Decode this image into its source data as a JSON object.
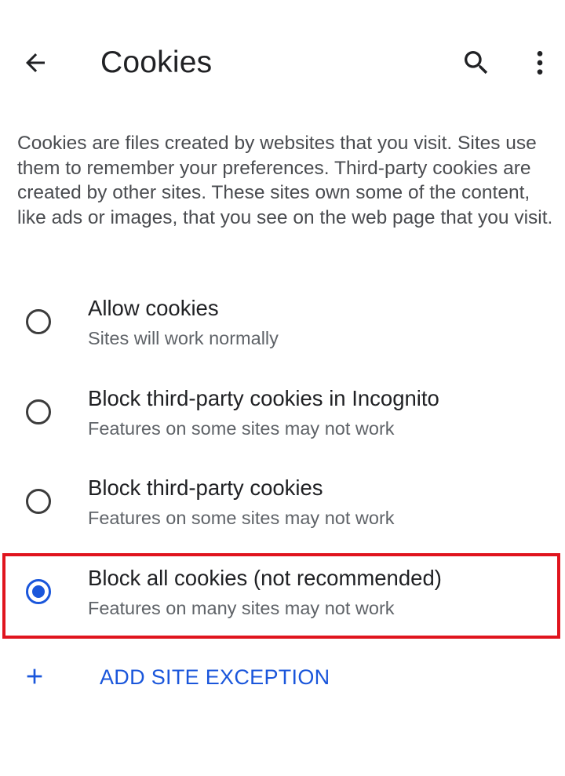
{
  "header": {
    "title": "Cookies",
    "back_icon": "arrow-back-icon",
    "search_icon": "search-icon",
    "more_icon": "more-vert-icon"
  },
  "description": "Cookies are files created by websites that you visit. Sites use them to remember your preferences. Third-party cookies are created by other sites. These sites own some of the content, like ads or images, that you see on the web page that you visit.",
  "options": [
    {
      "title": "Allow cookies",
      "subtitle": "Sites will work normally",
      "selected": false
    },
    {
      "title": "Block third-party cookies in Incognito",
      "subtitle": "Features on some sites may not work",
      "selected": false
    },
    {
      "title": "Block third-party cookies",
      "subtitle": "Features on some sites may not work",
      "selected": false
    },
    {
      "title": "Block all cookies (not recommended)",
      "subtitle": "Features on many sites may not work",
      "selected": true
    }
  ],
  "add_exception": {
    "label": "ADD SITE EXCEPTION",
    "icon": "plus-icon"
  },
  "colors": {
    "accent": "#1a56db",
    "highlight_border": "#e0141e",
    "text_primary": "#202124",
    "text_secondary": "#5f6368"
  }
}
